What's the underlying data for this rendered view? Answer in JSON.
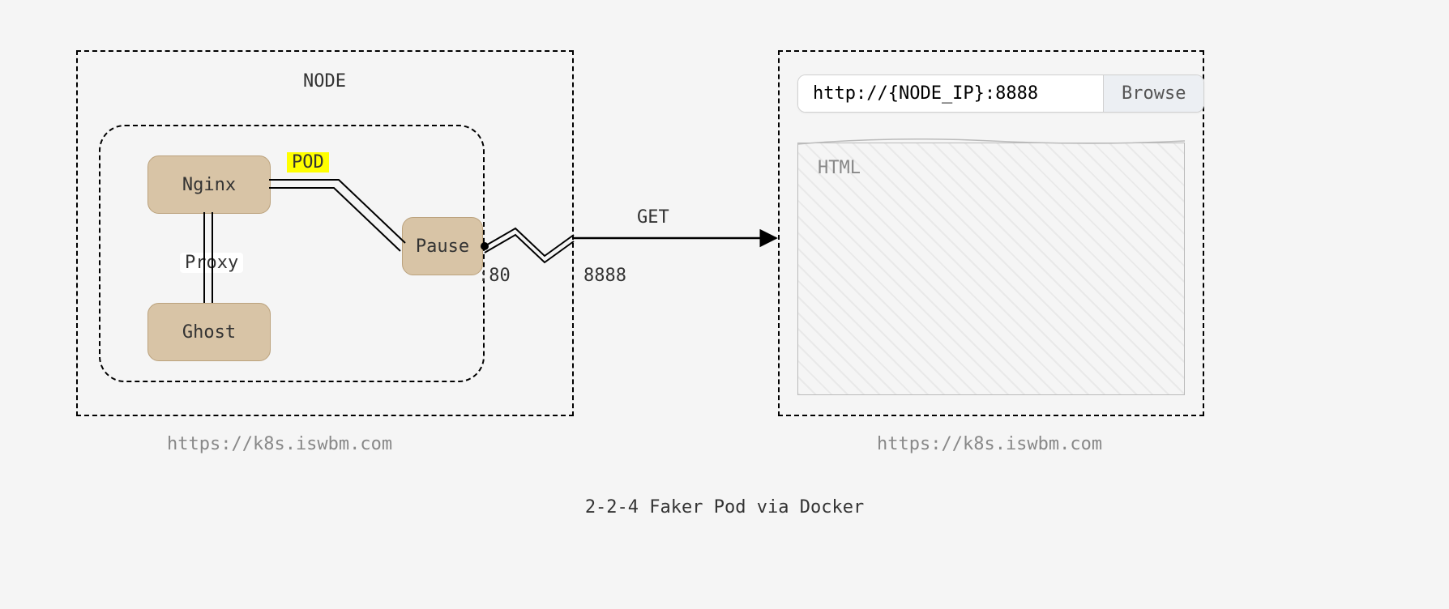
{
  "node": {
    "label": "NODE"
  },
  "pod": {
    "label": "POD"
  },
  "boxes": {
    "nginx": "Nginx",
    "ghost": "Ghost",
    "pause": "Pause",
    "proxy": "Proxy"
  },
  "ports": {
    "inner": ":80",
    "outer": "8888"
  },
  "request": {
    "method": "GET"
  },
  "browser": {
    "url": "http://{NODE_IP}:8888",
    "button": "Browse",
    "pane_label": "HTML"
  },
  "captions": {
    "left": "https://k8s.iswbm.com",
    "right": "https://k8s.iswbm.com"
  },
  "title": "2-2-4 Faker Pod via Docker"
}
